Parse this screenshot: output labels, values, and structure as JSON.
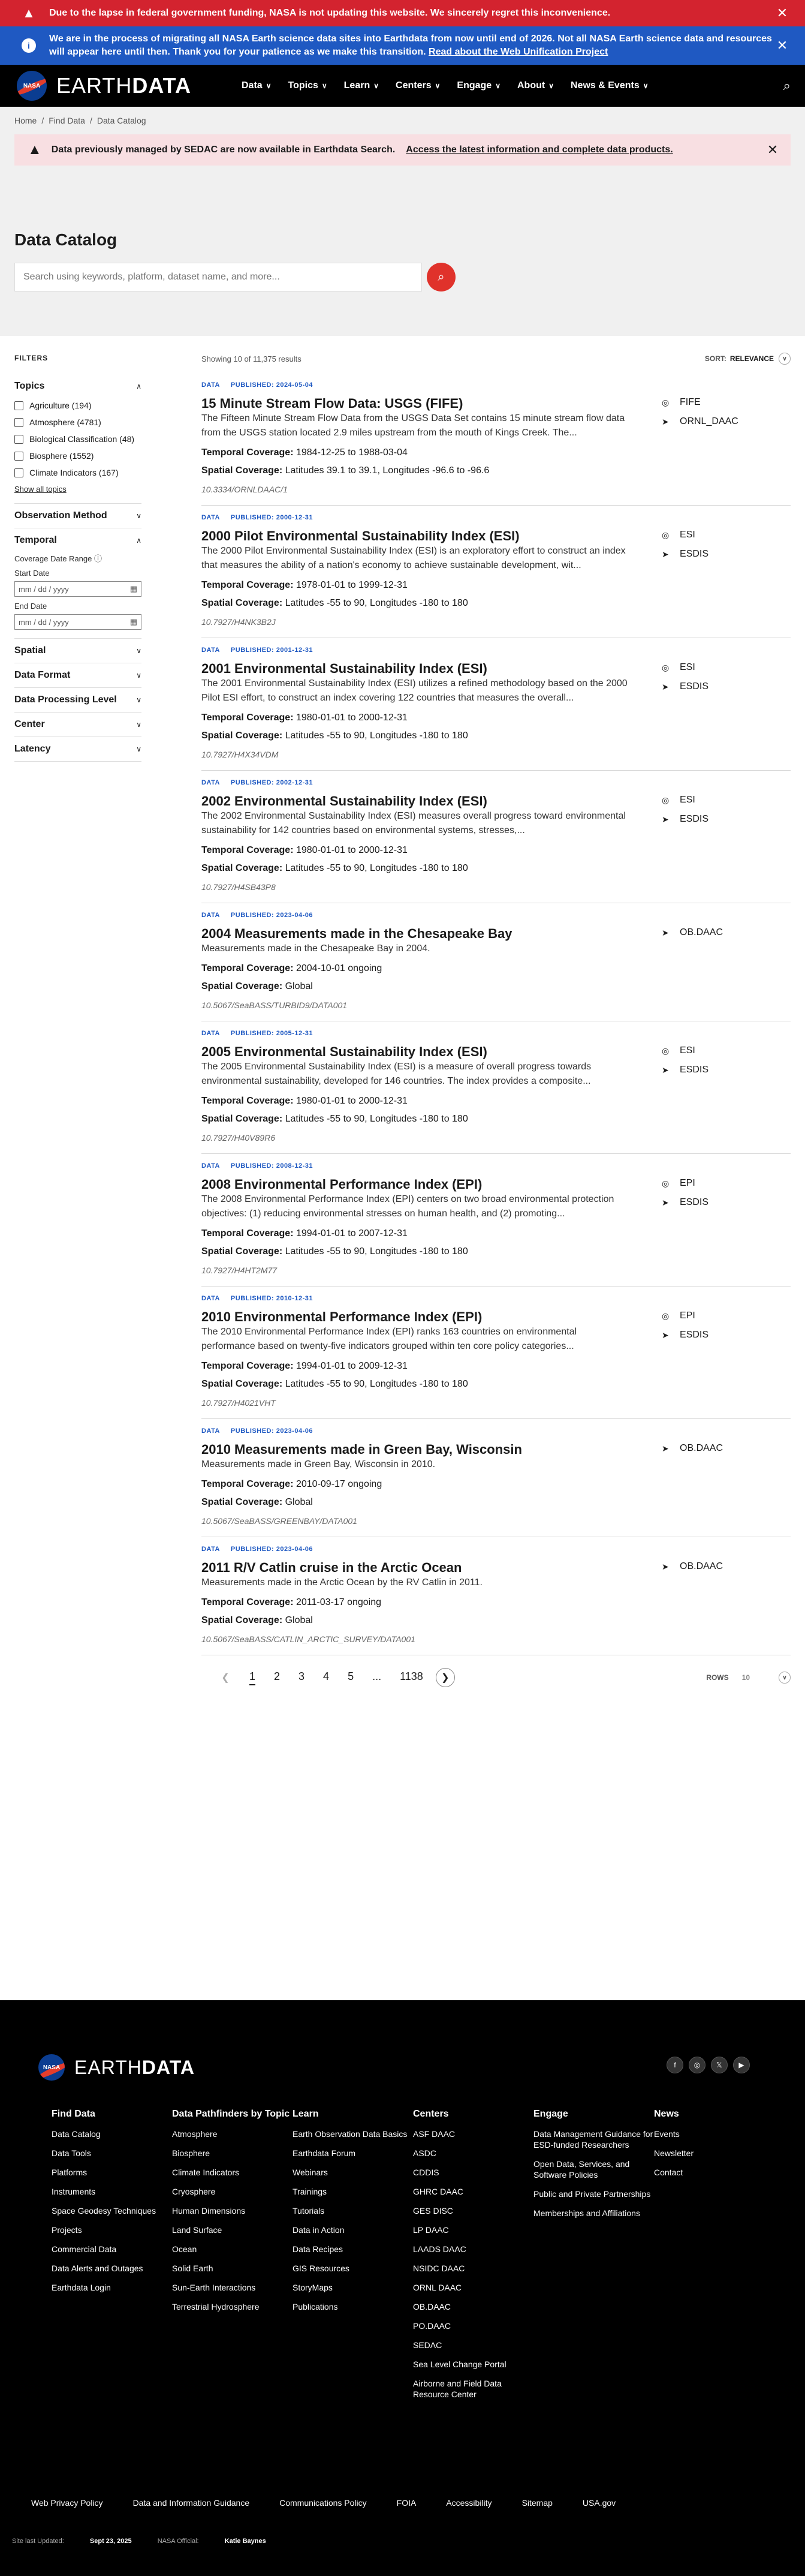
{
  "banners": {
    "shutdown": "Due to the lapse in federal government funding, NASA is not updating this website. We sincerely regret this inconvenience.",
    "migration": "We are in the process of migrating all NASA Earth science data sites into Earthdata from now until end of 2026. Not all NASA Earth science data and resources will appear here until then. Thank you for your patience as we make this transition.",
    "migration_link": "Read about the Web Unification Project"
  },
  "nav": {
    "logo_text": "NASA",
    "brand_earth": "EARTH",
    "brand_data": "DATA",
    "links": [
      "Data",
      "Topics",
      "Learn",
      "Centers",
      "Engage",
      "About",
      "News & Events"
    ]
  },
  "breadcrumb": [
    "Home",
    "Find Data",
    "Data Catalog"
  ],
  "alert": {
    "text": "Data previously managed by SEDAC are now available in Earthdata Search.",
    "link": "Access the latest information and complete data products."
  },
  "page": {
    "title": "Data Catalog",
    "search_placeholder": "Search using keywords, platform, dataset name, and more..."
  },
  "filters": {
    "heading": "FILTERS",
    "topics_title": "Topics",
    "topics": [
      "Agriculture (194)",
      "Atmosphere (4781)",
      "Biological Classification (48)",
      "Biosphere (1552)",
      "Climate Indicators (167)"
    ],
    "show_all": "Show all topics",
    "observation_method": "Observation Method",
    "temporal": "Temporal",
    "coverage_date_range": "Coverage Date Range",
    "start_date": "Start Date",
    "end_date": "End Date",
    "date_placeholder": "mm / dd / yyyy",
    "spatial": "Spatial",
    "data_format": "Data Format",
    "data_processing_level": "Data Processing Level",
    "center": "Center",
    "latency": "Latency"
  },
  "results_bar": {
    "count": "Showing 10 of 11,375 results",
    "sort_label": "SORT:",
    "sort_value": "RELEVANCE"
  },
  "labels": {
    "data_tag": "DATA",
    "temporal": "Temporal Coverage:",
    "spatial": "Spatial Coverage:"
  },
  "results": [
    {
      "published": "PUBLISHED: 2024-05-04",
      "title": "15 Minute Stream Flow Data: USGS (FIFE)",
      "desc": "The Fifteen Minute Stream Flow Data from the USGS Data Set contains 15 minute stream flow data from the USGS station located 2.9 miles upstream from the mouth of Kings Creek. The...",
      "temporal": "1984-12-25 to 1988-03-04",
      "spatial": "Latitudes 39.1 to 39.1, Longitudes -96.6 to -96.6",
      "doi": "10.3334/ORNLDAAC/1",
      "side": [
        {
          "icon": "satellite-icon",
          "glyph": "◎",
          "text": "FIFE"
        },
        {
          "icon": "location-arrow-icon",
          "glyph": "➤",
          "text": "ORNL_DAAC"
        }
      ]
    },
    {
      "published": "PUBLISHED: 2000-12-31",
      "title": "2000 Pilot Environmental Sustainability Index (ESI)",
      "desc": "The 2000 Pilot Environmental Sustainability Index (ESI) is an exploratory effort to construct an index that measures the ability of a nation's economy to achieve sustainable development, wit...",
      "temporal": "1978-01-01 to 1999-12-31",
      "spatial": "Latitudes -55 to 90, Longitudes -180 to 180",
      "doi": "10.7927/H4NK3B2J",
      "side": [
        {
          "icon": "satellite-icon",
          "glyph": "◎",
          "text": "ESI"
        },
        {
          "icon": "location-arrow-icon",
          "glyph": "➤",
          "text": "ESDIS"
        }
      ]
    },
    {
      "published": "PUBLISHED: 2001-12-31",
      "title": "2001 Environmental Sustainability Index (ESI)",
      "desc": "The 2001 Environmental Sustainability Index (ESI) utilizes a refined methodology based on the 2000 Pilot ESI effort, to construct an index covering 122 countries that measures the overall...",
      "temporal": "1980-01-01 to 2000-12-31",
      "spatial": "Latitudes -55 to 90, Longitudes -180 to 180",
      "doi": "10.7927/H4X34VDM",
      "side": [
        {
          "icon": "satellite-icon",
          "glyph": "◎",
          "text": "ESI"
        },
        {
          "icon": "location-arrow-icon",
          "glyph": "➤",
          "text": "ESDIS"
        }
      ]
    },
    {
      "published": "PUBLISHED: 2002-12-31",
      "title": "2002 Environmental Sustainability Index (ESI)",
      "desc": "The 2002 Environmental Sustainability Index (ESI) measures overall progress toward environmental sustainability for 142 countries based on environmental systems, stresses,...",
      "temporal": "1980-01-01 to 2000-12-31",
      "spatial": "Latitudes -55 to 90, Longitudes -180 to 180",
      "doi": "10.7927/H4SB43P8",
      "side": [
        {
          "icon": "satellite-icon",
          "glyph": "◎",
          "text": "ESI"
        },
        {
          "icon": "location-arrow-icon",
          "glyph": "➤",
          "text": "ESDIS"
        }
      ]
    },
    {
      "published": "PUBLISHED: 2023-04-06",
      "title": "2004 Measurements made in the Chesapeake Bay",
      "desc": "Measurements made in the Chesapeake Bay in 2004.",
      "temporal": "2004-10-01 ongoing",
      "spatial": "Global",
      "doi": "10.5067/SeaBASS/TURBID9/DATA001",
      "side": [
        {
          "icon": "location-arrow-icon",
          "glyph": "➤",
          "text": "OB.DAAC"
        }
      ]
    },
    {
      "published": "PUBLISHED: 2005-12-31",
      "title": "2005 Environmental Sustainability Index (ESI)",
      "desc": "The 2005 Environmental Sustainability Index (ESI) is a measure of overall progress towards environmental sustainability, developed for 146 countries. The index provides a composite...",
      "temporal": "1980-01-01 to 2000-12-31",
      "spatial": "Latitudes -55 to 90, Longitudes -180 to 180",
      "doi": "10.7927/H40V89R6",
      "side": [
        {
          "icon": "satellite-icon",
          "glyph": "◎",
          "text": "ESI"
        },
        {
          "icon": "location-arrow-icon",
          "glyph": "➤",
          "text": "ESDIS"
        }
      ]
    },
    {
      "published": "PUBLISHED: 2008-12-31",
      "title": "2008 Environmental Performance Index (EPI)",
      "desc": "The 2008 Environmental Performance Index (EPI) centers on two broad environmental protection objectives: (1) reducing environmental stresses on human health, and (2) promoting...",
      "temporal": "1994-01-01 to 2007-12-31",
      "spatial": "Latitudes -55 to 90, Longitudes -180 to 180",
      "doi": "10.7927/H4HT2M77",
      "side": [
        {
          "icon": "satellite-icon",
          "glyph": "◎",
          "text": "EPI"
        },
        {
          "icon": "location-arrow-icon",
          "glyph": "➤",
          "text": "ESDIS"
        }
      ]
    },
    {
      "published": "PUBLISHED: 2010-12-31",
      "title": "2010 Environmental Performance Index (EPI)",
      "desc": "The 2010 Environmental Performance Index (EPI) ranks 163 countries on environmental performance based on twenty-five indicators grouped within ten core policy categories...",
      "temporal": "1994-01-01 to 2009-12-31",
      "spatial": "Latitudes -55 to 90, Longitudes -180 to 180",
      "doi": "10.7927/H4021VHT",
      "side": [
        {
          "icon": "satellite-icon",
          "glyph": "◎",
          "text": "EPI"
        },
        {
          "icon": "location-arrow-icon",
          "glyph": "➤",
          "text": "ESDIS"
        }
      ]
    },
    {
      "published": "PUBLISHED: 2023-04-06",
      "title": "2010 Measurements made in Green Bay, Wisconsin",
      "desc": "Measurements made in Green Bay, Wisconsin in 2010.",
      "temporal": "2010-09-17 ongoing",
      "spatial": "Global",
      "doi": "10.5067/SeaBASS/GREENBAY/DATA001",
      "side": [
        {
          "icon": "location-arrow-icon",
          "glyph": "➤",
          "text": "OB.DAAC"
        }
      ]
    },
    {
      "published": "PUBLISHED: 2023-04-06",
      "title": "2011 R/V Catlin cruise in the Arctic Ocean",
      "desc": "Measurements made in the Arctic Ocean by the RV Catlin in 2011.",
      "temporal": "2011-03-17 ongoing",
      "spatial": "Global",
      "doi": "10.5067/SeaBASS/CATLIN_ARCTIC_SURVEY/DATA001",
      "side": [
        {
          "icon": "location-arrow-icon",
          "glyph": "➤",
          "text": "OB.DAAC"
        }
      ]
    }
  ],
  "pagination": {
    "pages": [
      "1",
      "2",
      "3",
      "4",
      "5",
      "...",
      "1138"
    ],
    "rows_label": "ROWS",
    "rows_value": "10"
  },
  "footer": {
    "social": [
      {
        "name": "facebook-icon",
        "glyph": "f"
      },
      {
        "name": "instagram-icon",
        "glyph": "◎"
      },
      {
        "name": "x-icon",
        "glyph": "𝕏"
      },
      {
        "name": "youtube-icon",
        "glyph": "▶"
      }
    ],
    "columns": [
      {
        "title": "Find Data",
        "links": [
          "Data Catalog",
          "Data Tools",
          "Platforms",
          "Instruments",
          "Space Geodesy Techniques",
          "Projects",
          "Commercial Data",
          "Data Alerts and Outages",
          "Earthdata Login"
        ]
      },
      {
        "title": "Data Pathfinders by Topic",
        "links": [
          "Atmosphere",
          "Biosphere",
          "Climate Indicators",
          "Cryosphere",
          "Human Dimensions",
          "Land Surface",
          "Ocean",
          "Solid Earth",
          "Sun-Earth Interactions",
          "Terrestrial Hydrosphere"
        ]
      },
      {
        "title": "Learn",
        "links": [
          "Earth Observation Data Basics",
          "Earthdata Forum",
          "Webinars",
          "Trainings",
          "Tutorials",
          "Data in Action",
          "Data Recipes",
          "GIS Resources",
          "StoryMaps",
          "Publications"
        ]
      },
      {
        "title": "Centers",
        "links": [
          "ASF DAAC",
          "ASDC",
          "CDDIS",
          "GHRC DAAC",
          "GES DISC",
          "LP DAAC",
          "LAADS DAAC",
          "NSIDC DAAC",
          "ORNL DAAC",
          "OB.DAAC",
          "PO.DAAC",
          "SEDAC",
          "Sea Level Change Portal",
          "Airborne and Field Data Resource Center"
        ]
      },
      {
        "title": "Engage",
        "links": [
          "Data Management Guidance for ESD-funded Researchers",
          "Open Data, Services, and Software Policies",
          "Public and Private Partnerships",
          "Memberships and Affiliations"
        ]
      },
      {
        "title": "News",
        "links": [
          "Events",
          "Newsletter",
          "Contact"
        ]
      }
    ],
    "bottom_links": [
      "Web Privacy Policy",
      "Data and Information Guidance",
      "Communications Policy",
      "FOIA",
      "Accessibility",
      "Sitemap",
      "USA.gov"
    ],
    "updated_label": "Site last Updated:",
    "updated_value": "Sept 23, 2025",
    "official_label": "NASA Official:",
    "official_value": "Katie Baynes"
  }
}
